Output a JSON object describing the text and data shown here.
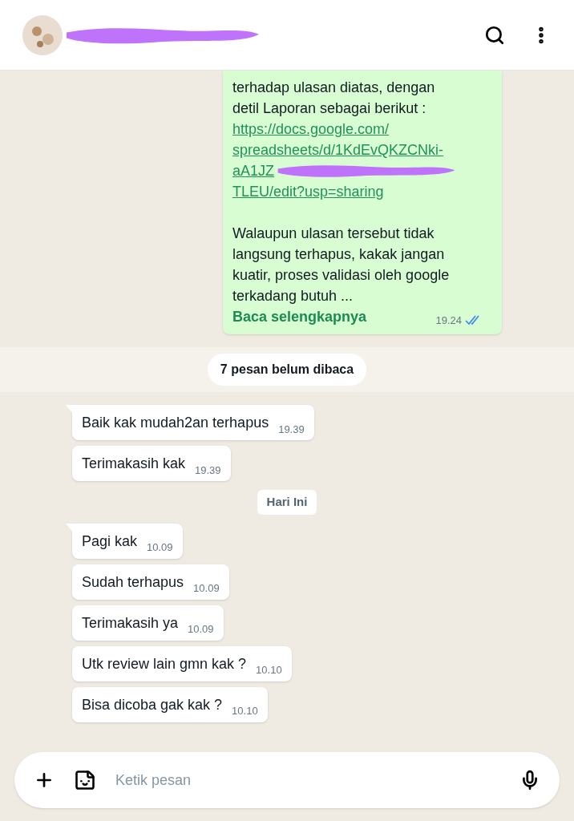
{
  "header": {
    "redacted": true
  },
  "outgoing": {
    "lines": [
      "terhadap ulasan diatas, dengan",
      "detil Laporan sebagai berikut :"
    ],
    "link": [
      "https://docs.google.com/",
      "spreadsheets/d/1KdEvQKZCNki-",
      "aA1JZ",
      "TLEU/edit?usp=sharing"
    ],
    "paragraph": "Walaupun ulasan tersebut tidak langsung terhapus, kakak jangan kuatir, proses validasi oleh google terkadang butuh ...",
    "read_more": "Baca selengkapnya",
    "time": "19.24",
    "read": true
  },
  "unread_banner": "7 pesan belum dibaca",
  "groups": [
    {
      "messages": [
        {
          "text": "Baik kak mudah2an terhapus",
          "time": "19.39",
          "tail": true
        },
        {
          "text": "Terimakasih kak",
          "time": "19.39",
          "tail": false
        }
      ]
    },
    {
      "date": "Hari Ini",
      "messages": [
        {
          "text": "Pagi kak",
          "time": "10.09",
          "tail": true
        },
        {
          "text": "Sudah terhapus",
          "time": "10.09",
          "tail": false
        },
        {
          "text": "Terimakasih ya",
          "time": "10.09",
          "tail": false
        },
        {
          "text": "Utk review lain gmn kak ?",
          "time": "10.10",
          "tail": false
        },
        {
          "text": "Bisa dicoba gak kak ?",
          "time": "10.10",
          "tail": false
        }
      ]
    }
  ],
  "composer": {
    "placeholder": "Ketik pesan"
  }
}
